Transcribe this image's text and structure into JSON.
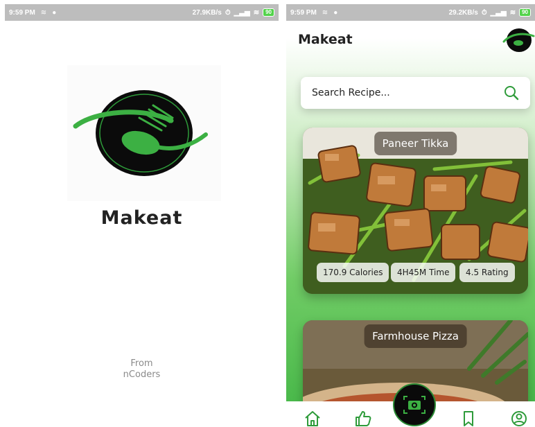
{
  "left_screen": {
    "status_bar": {
      "time": "9:59 PM",
      "network_speed": "27.9KB/s",
      "battery": "90"
    },
    "brand_name": "Makeat",
    "from_label": "From",
    "company": "nCoders"
  },
  "right_screen": {
    "status_bar": {
      "time": "9:59 PM",
      "network_speed": "29.2KB/s",
      "battery": "90"
    },
    "header": {
      "title": "Makeat"
    },
    "search": {
      "placeholder": "Search Recipe..."
    },
    "recipes": [
      {
        "name": "Paneer Tikka",
        "calories": "170.9 Calories",
        "time": "4H45M Time",
        "rating": "4.5 Rating"
      },
      {
        "name": "Farmhouse Pizza"
      }
    ],
    "bottom_nav": [
      {
        "icon": "home-icon"
      },
      {
        "icon": "thumbs-up-icon"
      },
      {
        "icon": "camera-icon"
      },
      {
        "icon": "bookmark-icon"
      },
      {
        "icon": "profile-icon"
      }
    ]
  },
  "colors": {
    "brand_green": "#3cb043",
    "logo_black": "#0d0d0d",
    "status_bar": "#bdbdbd"
  }
}
